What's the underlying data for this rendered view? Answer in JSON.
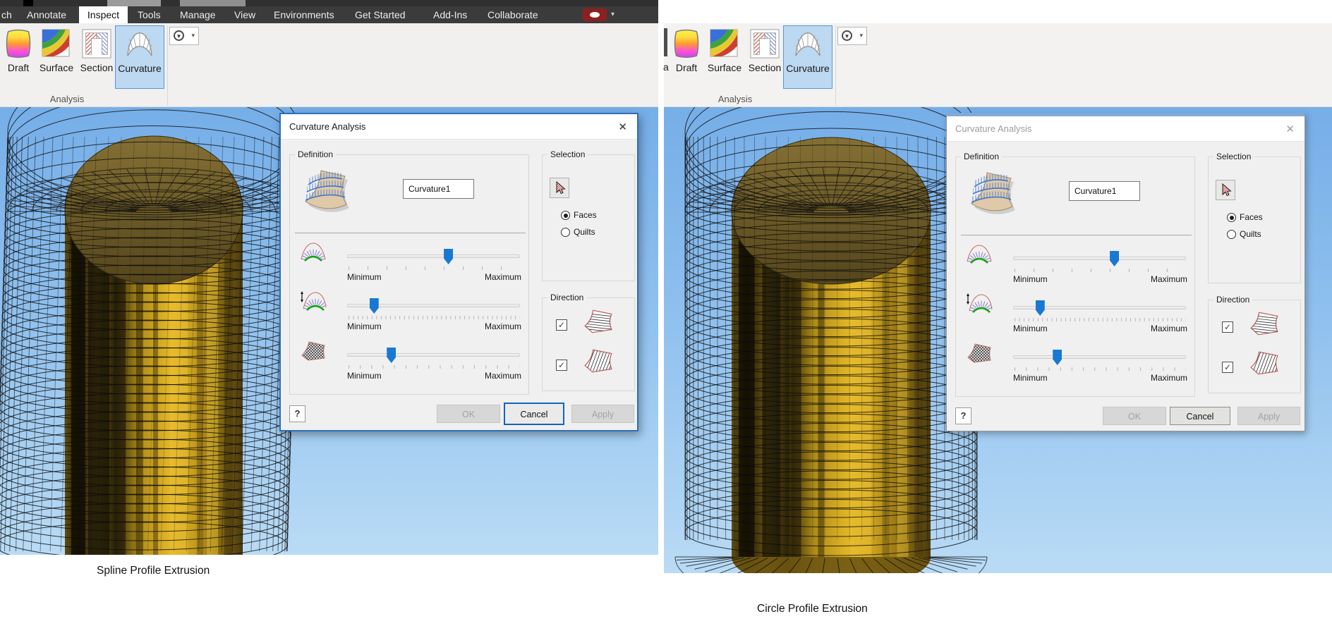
{
  "window": {
    "top_tabs": [
      "ch",
      "Annotate",
      "Inspect",
      "Tools",
      "Manage",
      "View",
      "Environments",
      "Get Started",
      "Add-Ins",
      "Collaborate"
    ],
    "active_tab": "Inspect"
  },
  "ribbon": {
    "tools": [
      "Draft",
      "Surface",
      "Section",
      "Curvature"
    ],
    "active_tool": "Curvature",
    "group_label": "Analysis",
    "cut_label": "a"
  },
  "dialog": {
    "title": "Curvature Analysis",
    "left_state": "active",
    "right_state": "inactive",
    "definition": {
      "label": "Definition",
      "name_value": "Curvature1"
    },
    "sliders": [
      {
        "name": "maximum-curvature",
        "min": "Minimum",
        "max": "Maximum",
        "value_pct": 58,
        "ticks": 10
      },
      {
        "name": "minimum-curvature",
        "min": "Minimum",
        "max": "Maximum",
        "value_pct": 15,
        "ticks": 38
      },
      {
        "name": "mesh-density",
        "min": "Minimum",
        "max": "Maximum",
        "value_pct": 25,
        "ticks": 16
      }
    ],
    "selection": {
      "label": "Selection",
      "options": [
        {
          "label": "Faces",
          "selected": true
        },
        {
          "label": "Quilts",
          "selected": false
        }
      ]
    },
    "direction": {
      "label": "Direction",
      "checkboxes": [
        {
          "checked": true
        },
        {
          "checked": true
        }
      ]
    },
    "buttons": {
      "ok": "OK",
      "cancel": "Cancel",
      "apply": "Apply",
      "ok_enabled": false,
      "apply_enabled": false
    }
  },
  "viewports": {
    "left_caption": "Spline Profile Extrusion",
    "right_caption": "Circle Profile Extrusion"
  },
  "icons": {
    "close": "✕",
    "help": "?",
    "triangle": "▼",
    "caret": "▾",
    "check": "✓"
  },
  "colors": {
    "accent_blue": "#1878d2",
    "tile_highlight": "#bdd8f1",
    "viewport_top": "#76aee8",
    "viewport_bottom": "#b9dbf5",
    "gold": "#d8ac20",
    "menubar": "#3b3b3b"
  }
}
